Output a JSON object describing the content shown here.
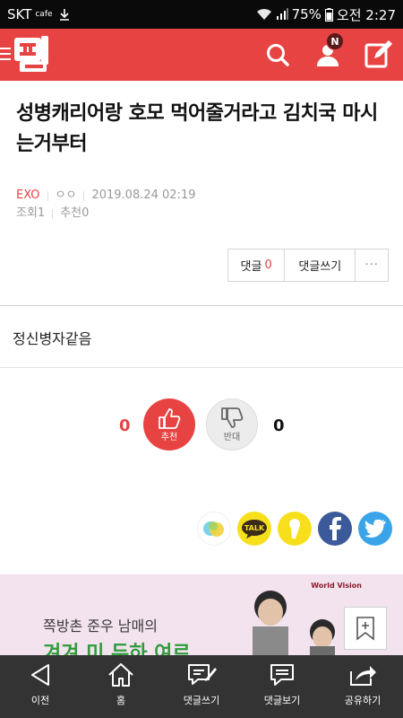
{
  "status_bar": {
    "carrier": "SKT",
    "carrier_sub": "cafe",
    "battery": "75%",
    "time": "오전 2:27"
  },
  "app_bar": {
    "logo_text": "판",
    "notification_badge": "N",
    "brand_color": "#e84343"
  },
  "post": {
    "title": "성병캐리어랑 호모 먹어줄거라고 김치국 마시는거부터",
    "category": "EXO",
    "author": "ㅇㅇ",
    "datetime": "2019.08.24 02:19",
    "views_label": "조회",
    "views": "1",
    "recommend_label": "추천",
    "recommend": "0",
    "body": "정신병자같음"
  },
  "comments": {
    "label": "댓글",
    "count": "0",
    "write_label": "댓글쓰기",
    "more_label": "···"
  },
  "vote": {
    "up_count": "0",
    "up_label": "추천",
    "down_label": "반대",
    "down_count": "0"
  },
  "share": {
    "items": [
      "clien-icon",
      "kakaotalk-icon",
      "kakaostory-icon",
      "facebook-icon",
      "twitter-icon"
    ],
    "kakaotalk_text": "TALK"
  },
  "ad": {
    "brand": "World Vision",
    "line1": "쪽방촌 준우 남매의",
    "line2": "겨겨 미 두하 여르"
  },
  "bottom_nav": [
    {
      "label": "이전",
      "icon": "back-icon"
    },
    {
      "label": "홈",
      "icon": "home-icon"
    },
    {
      "label": "댓글쓰기",
      "icon": "write-comment-icon"
    },
    {
      "label": "댓글보기",
      "icon": "view-comments-icon"
    },
    {
      "label": "공유하기",
      "icon": "share-icon"
    }
  ]
}
